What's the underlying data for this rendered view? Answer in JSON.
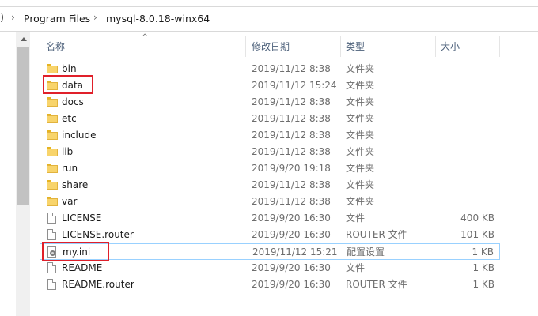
{
  "address": {
    "edge": ")",
    "crumbs": [
      "Program Files",
      "mysql-8.0.18-winx64"
    ]
  },
  "columns": {
    "name": "名称",
    "date": "修改日期",
    "type": "类型",
    "size": "大小"
  },
  "files": [
    {
      "name": "bin",
      "date": "2019/11/12 8:38",
      "type": "文件夹",
      "size": "",
      "icon": "folder-icon"
    },
    {
      "name": "data",
      "date": "2019/11/12 15:24",
      "type": "文件夹",
      "size": "",
      "icon": "folder-icon"
    },
    {
      "name": "docs",
      "date": "2019/11/12 8:38",
      "type": "文件夹",
      "size": "",
      "icon": "folder-icon"
    },
    {
      "name": "etc",
      "date": "2019/11/12 8:38",
      "type": "文件夹",
      "size": "",
      "icon": "folder-icon"
    },
    {
      "name": "include",
      "date": "2019/11/12 8:38",
      "type": "文件夹",
      "size": "",
      "icon": "folder-icon"
    },
    {
      "name": "lib",
      "date": "2019/11/12 8:38",
      "type": "文件夹",
      "size": "",
      "icon": "folder-icon"
    },
    {
      "name": "run",
      "date": "2019/9/20 19:18",
      "type": "文件夹",
      "size": "",
      "icon": "folder-icon"
    },
    {
      "name": "share",
      "date": "2019/11/12 8:38",
      "type": "文件夹",
      "size": "",
      "icon": "folder-icon"
    },
    {
      "name": "var",
      "date": "2019/11/12 8:38",
      "type": "文件夹",
      "size": "",
      "icon": "folder-icon"
    },
    {
      "name": "LICENSE",
      "date": "2019/9/20 16:30",
      "type": "文件",
      "size": "400 KB",
      "icon": "file-icon"
    },
    {
      "name": "LICENSE.router",
      "date": "2019/9/20 16:30",
      "type": "ROUTER 文件",
      "size": "101 KB",
      "icon": "file-icon"
    },
    {
      "name": "my.ini",
      "date": "2019/11/12 15:21",
      "type": "配置设置",
      "size": "1 KB",
      "icon": "settings-file-icon"
    },
    {
      "name": "README",
      "date": "2019/9/20 16:30",
      "type": "文件",
      "size": "1 KB",
      "icon": "file-icon"
    },
    {
      "name": "README.router",
      "date": "2019/9/20 16:30",
      "type": "ROUTER 文件",
      "size": "1 KB",
      "icon": "file-icon"
    }
  ],
  "highlight_color": "#e0202a",
  "selection_border_color": "#99d1ff"
}
